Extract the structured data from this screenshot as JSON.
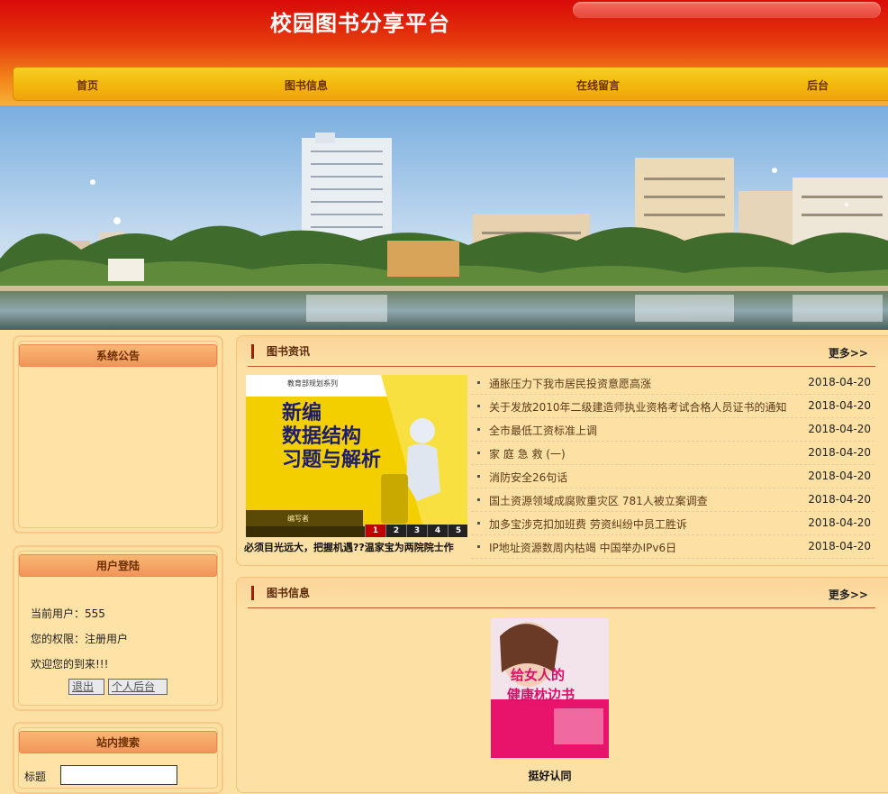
{
  "site": {
    "title": "校园图书分享平台"
  },
  "nav": [
    {
      "label": "首页"
    },
    {
      "label": "图书信息"
    },
    {
      "label": "在线留言"
    },
    {
      "label": "后台"
    }
  ],
  "sidebar": {
    "notice": {
      "title": "系统公告"
    },
    "login": {
      "title": "用户登陆",
      "current_user": "当前用户：555",
      "permission": "您的权限：注册用户",
      "welcome": "欢迎您的到来!!!",
      "logout_label": "退出",
      "backend_label": "个人后台"
    },
    "search": {
      "title": "站内搜索",
      "field_label": "标题",
      "field_value": ""
    }
  },
  "news": {
    "title": "图书资讯",
    "more": "更多>>",
    "slide_caption": "必须目光远大，把握机遇??温家宝为两院院士作",
    "slide_pages": [
      "1",
      "2",
      "3",
      "4",
      "5"
    ],
    "cover": {
      "series": "教育部规划系列",
      "line1": "新编",
      "line2": "数据结构",
      "line3": "习题与解析",
      "footer": "编写者"
    },
    "items": [
      {
        "title": "通胀压力下我市居民投资意愿高涨",
        "date": "2018-04-20"
      },
      {
        "title": "关于发放2010年二级建造师执业资格考试合格人员证书的通知",
        "date": "2018-04-20"
      },
      {
        "title": "全市最低工资标准上调",
        "date": "2018-04-20"
      },
      {
        "title": "家 庭 急 救 (一)",
        "date": "2018-04-20"
      },
      {
        "title": "消防安全26句话",
        "date": "2018-04-20"
      },
      {
        "title": "国土资源领域成腐败重灾区 781人被立案调查",
        "date": "2018-04-20"
      },
      {
        "title": "加多宝涉克扣加班费 劳资纠纷中员工胜诉",
        "date": "2018-04-20"
      },
      {
        "title": "IP地址资源数周内枯竭 中国举办IPv6日",
        "date": "2018-04-20"
      }
    ]
  },
  "books": {
    "title": "图书信息",
    "more": "更多>>",
    "items": [
      {
        "name": "挺好认同",
        "cover_text_1": "给女人的",
        "cover_text_2": "健康枕边书"
      }
    ]
  },
  "colors": {
    "header_top": "#d80a08",
    "nav_gold": "#f3b80d",
    "page_bg": "#fde0a3",
    "accent_red": "#a0200a"
  }
}
